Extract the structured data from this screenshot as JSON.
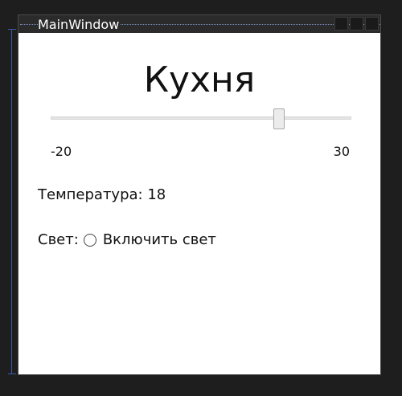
{
  "window": {
    "title": "MainWindow"
  },
  "room": {
    "title": "Кухня"
  },
  "temperature_slider": {
    "min_label": "-20",
    "max_label": "30",
    "min": -20,
    "max": 30,
    "value": 18
  },
  "temperature": {
    "label": "Температура:",
    "value": "18"
  },
  "light": {
    "label": "Свет:",
    "radio_label": "Включить свет",
    "checked": false
  }
}
